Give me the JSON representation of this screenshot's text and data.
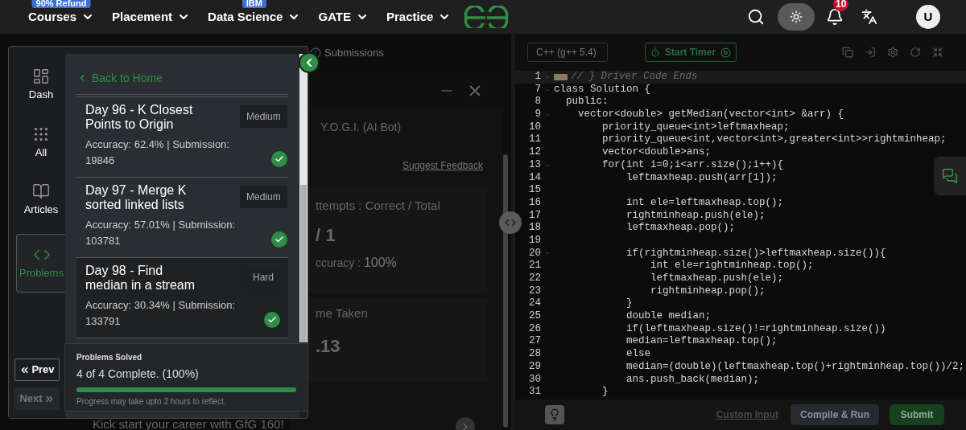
{
  "nav": {
    "menu": [
      {
        "label": "Courses",
        "badge": "90% Refund"
      },
      {
        "label": "Placement"
      },
      {
        "label": "Data Science",
        "badge": "IBM"
      },
      {
        "label": "GATE"
      },
      {
        "label": "Practice"
      }
    ],
    "notifications": "10",
    "avatar": "U"
  },
  "problem_panel": {
    "tab": "Submissions",
    "bot_title": "Y.O.G.I. (AI Bot)",
    "feedback_link": "Suggest Feedback",
    "attempts_label": "ttempts : Correct / Total",
    "attempts_value": "/ 1",
    "accuracy_label": "ccuracy : ",
    "accuracy_value": "100%",
    "time_label": "me Taken",
    "time_value": ".13",
    "banner": "Kick start your career with GfG 160!"
  },
  "sidebar": {
    "rail": [
      {
        "label": "Dash",
        "selected": false
      },
      {
        "label": "All",
        "selected": false
      },
      {
        "label": "Articles",
        "selected": false
      },
      {
        "label": "Problems",
        "selected": true
      }
    ],
    "back_link": "Back to Home",
    "problems": [
      {
        "title": "Day 96 - K Closest Points to Origin",
        "difficulty": "Medium",
        "stats": "Accuracy: 62.4% | Submission: 19846",
        "solved": true,
        "selected": false
      },
      {
        "title": "Day 97 - Merge K sorted linked lists",
        "difficulty": "Medium",
        "stats": "Accuracy: 57.01% | Submission: 103781",
        "solved": true,
        "selected": false
      },
      {
        "title": "Day 98 - Find median in a stream",
        "difficulty": "Hard",
        "stats": "Accuracy: 30.34% | Submission: 133791",
        "solved": true,
        "selected": true
      }
    ],
    "progress": {
      "title": "Problems Solved",
      "summary": "4 of 4 Complete. (100%)",
      "level": 1,
      "note": "Progress may take upto 2 hours to reflect."
    },
    "pager": [
      {
        "label": "Prev",
        "disabled": false
      },
      {
        "label": "Next",
        "disabled": true
      }
    ]
  },
  "editor": {
    "language": "C++ (g++ 5.4)",
    "timer_button": "Start Timer",
    "lines": [
      {
        "number": "1",
        "text": "// } Driver Code Ends",
        "kind": "folded",
        "folded": true
      },
      {
        "number": "7",
        "text": "class Solution {",
        "kind": "code",
        "folded": false
      },
      {
        "number": "8",
        "text": "  public:",
        "kind": "code"
      },
      {
        "number": "9",
        "text": "    vector<double> getMedian(vector<int> &arr) {",
        "kind": "code",
        "folded": false
      },
      {
        "number": "10",
        "text": "        priority_queue<int>leftmaxheap;",
        "kind": "code"
      },
      {
        "number": "11",
        "text": "        priority_queue<int,vector<int>,greater<int>>rightminheap;",
        "kind": "code"
      },
      {
        "number": "12",
        "text": "        vector<double>ans;",
        "kind": "code"
      },
      {
        "number": "13",
        "text": "        for(int i=0;i<arr.size();i++){",
        "kind": "code",
        "folded": false
      },
      {
        "number": "14",
        "text": "            leftmaxheap.push(arr[i]);",
        "kind": "code"
      },
      {
        "number": "15",
        "kind": "code"
      },
      {
        "number": "16",
        "text": "            int ele=leftmaxheap.top();",
        "kind": "code"
      },
      {
        "number": "17",
        "text": "            rightminheap.push(ele);",
        "kind": "code"
      },
      {
        "number": "18",
        "text": "            leftmaxheap.pop();",
        "kind": "code"
      },
      {
        "number": "19",
        "kind": "code"
      },
      {
        "number": "20",
        "text": "            if(rightminheap.size()>leftmaxheap.size()){",
        "kind": "code",
        "folded": false
      },
      {
        "number": "21",
        "text": "                int ele=rightminheap.top();",
        "kind": "code"
      },
      {
        "number": "22",
        "text": "                leftmaxheap.push(ele);",
        "kind": "code"
      },
      {
        "number": "23",
        "text": "                rightminheap.pop();",
        "kind": "code"
      },
      {
        "number": "24",
        "text": "            }",
        "kind": "code"
      },
      {
        "number": "25",
        "text": "            double median;",
        "kind": "code"
      },
      {
        "number": "26",
        "text": "            if(leftmaxheap.size()!=rightminheap.size())",
        "kind": "code"
      },
      {
        "number": "27",
        "text": "            median=leftmaxheap.top();",
        "kind": "code"
      },
      {
        "number": "28",
        "text": "            else",
        "kind": "code"
      },
      {
        "number": "29",
        "text": "            median=(double)(leftmaxheap.top()+rightminheap.top())/2;",
        "kind": "code"
      },
      {
        "number": "30",
        "text": "            ans.push_back(median);",
        "kind": "code"
      },
      {
        "number": "31",
        "text": "        }",
        "kind": "code"
      }
    ],
    "custom_input": "Custom Input",
    "run_button": "Compile & Run",
    "submit_button": "Submit"
  }
}
